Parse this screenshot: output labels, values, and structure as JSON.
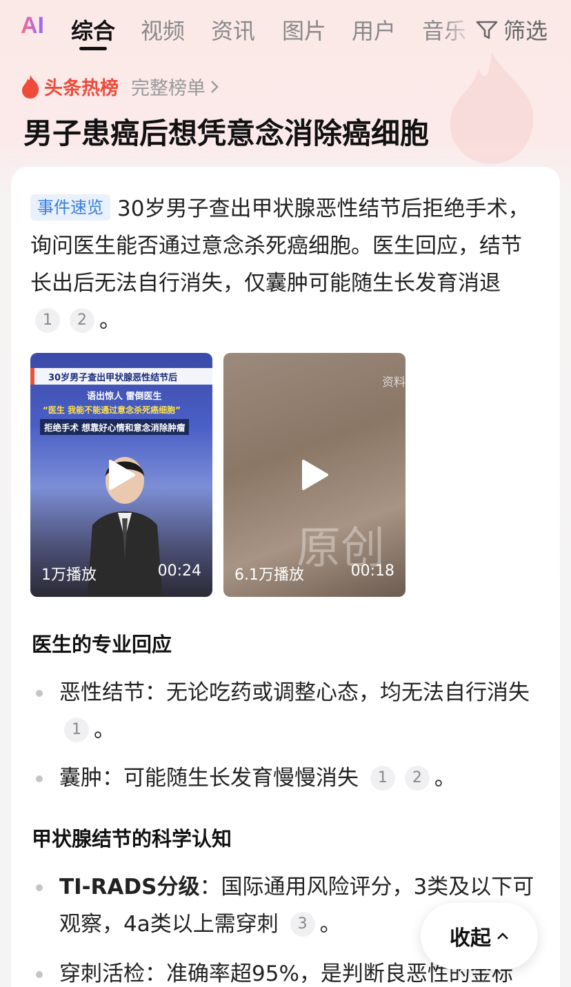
{
  "tabs": {
    "ai_label": "AI",
    "items": [
      "综合",
      "视频",
      "资讯",
      "图片",
      "用户",
      "音乐"
    ],
    "filter_label": "筛选"
  },
  "hot": {
    "label": "头条热榜",
    "link": "完整榜单"
  },
  "title": "男子患癌后想凭意念消除癌细胞",
  "summary": {
    "badge": "事件速览",
    "text": "30岁男子查出甲状腺恶性结节后拒绝手术，询问医生能否通过意念杀死癌细胞。医生回应，结节长出后无法自行消失，仅囊肿可能随生长发育消退",
    "refs": [
      "1",
      "2"
    ],
    "end": "。"
  },
  "videos": [
    {
      "plays": "1万播放",
      "duration": "00:24",
      "overlay": [
        "30岁男子查出甲状腺恶性结节后",
        "语出惊人 雷倒医生",
        "“医生 我能不能通过意念杀死癌细胞”",
        "拒绝手术 想靠好心情和意念消除肿瘤"
      ]
    },
    {
      "plays": "6.1万播放",
      "duration": "00:18",
      "overlay": [
        "资料",
        "原创"
      ]
    }
  ],
  "sections": [
    {
      "title": "医生的专业回应",
      "bullets": [
        {
          "strong": "",
          "text": "恶性结节：无论吃药或调整心态，均无法自行消失",
          "refs": [
            "1"
          ],
          "end": "。"
        },
        {
          "strong": "",
          "text": "囊肿：可能随生长发育慢慢消失",
          "refs": [
            "1",
            "2"
          ],
          "end": "。"
        }
      ]
    },
    {
      "title": "甲状腺结节的科学认知",
      "bullets": [
        {
          "strong": "TI-RADS分级",
          "text": "：国际通用风险评分，3类及以下可观察，4a类以上需穿刺",
          "refs": [
            "3"
          ],
          "end": "。"
        },
        {
          "strong": "",
          "text": "穿刺活检：准确率超95%，是判断良恶性的金标",
          "refs": [],
          "end": ""
        }
      ]
    }
  ],
  "collapse_label": "收起",
  "colors": {
    "hot_red": "#f04a3a",
    "badge_blue": "#3a7ee0",
    "badge_bg": "#e8f1fd"
  }
}
